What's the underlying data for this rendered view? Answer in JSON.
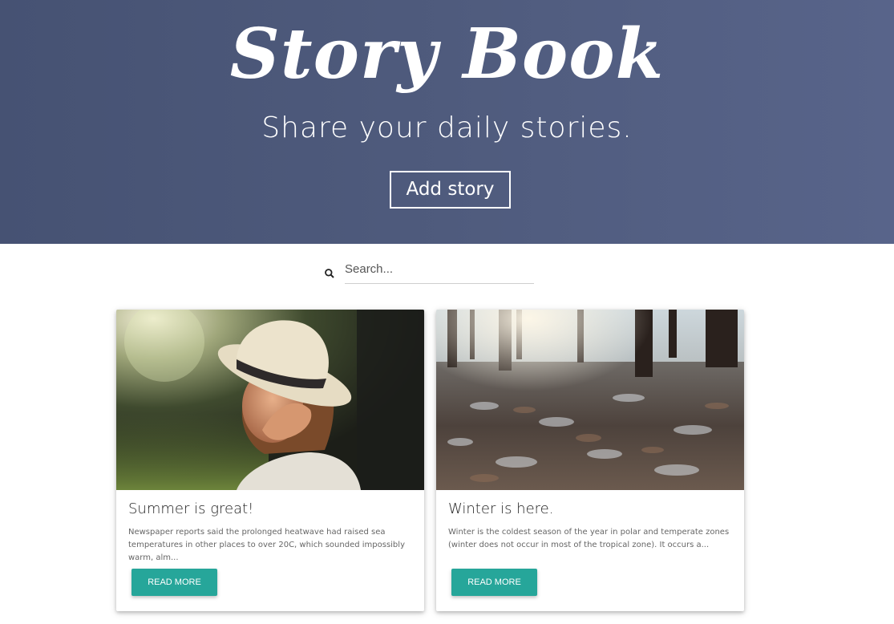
{
  "hero": {
    "title": "Story Book",
    "subtitle": "Share your daily stories.",
    "add_button_label": "Add story",
    "background_colors": [
      "#465273",
      "#58648a"
    ]
  },
  "search": {
    "placeholder": "Search...",
    "value": "",
    "icon": "search-icon"
  },
  "stories": [
    {
      "title": "Summer is great!",
      "excerpt": "Newspaper reports said the prolonged heatwave had raised sea temperatures in other places to over 20C, which sounded impossibly warm, alm...",
      "button_label": "READ MORE",
      "image": "woman in straw hat in sunlit forest"
    },
    {
      "title": "Winter is here.",
      "excerpt": "Winter is the coldest season of the year in polar and temperate zones (winter does not occur in most of the tropical zone). It occurs a...",
      "button_label": "READ MORE",
      "image": "frost-covered leaves in winter forest"
    }
  ],
  "colors": {
    "accent": "#26a69a"
  }
}
